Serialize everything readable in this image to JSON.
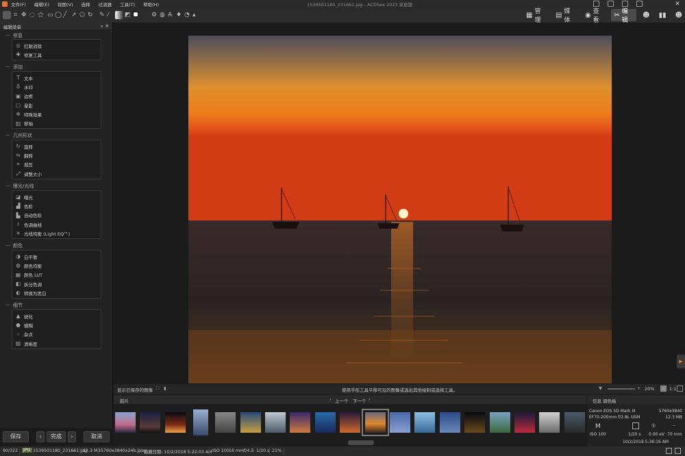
{
  "menu": [
    "文件(F)",
    "编辑(E)",
    "视图(V)",
    "选择",
    "过滤器",
    "工具(T)",
    "帮助(H)"
  ],
  "window_title": "1539501180_231661.jpg - ACDSee 2023 家庭版",
  "modes": [
    {
      "label": "管理",
      "icon": "grid-icon"
    },
    {
      "label": "媒体",
      "icon": "media-icon"
    },
    {
      "label": "查看",
      "icon": "eye-icon"
    },
    {
      "label": "编辑",
      "icon": "edit-icon"
    }
  ],
  "left_panel": {
    "title": "编辑菜单",
    "groups": [
      {
        "title": "修复",
        "items": [
          "红眼消除",
          "修复工具"
        ]
      },
      {
        "title": "添加",
        "items": [
          "文本",
          "水印",
          "边框",
          "晕影",
          "特殊效果",
          "移轴"
        ]
      },
      {
        "title": "几何形状",
        "items": [
          "旋转",
          "翻转",
          "裁剪",
          "调整大小"
        ]
      },
      {
        "title": "曝光/光线",
        "items": [
          "曝光",
          "色阶",
          "自动色阶",
          "色调曲线",
          "光线均衡 (Light EQ™)"
        ]
      },
      {
        "title": "颜色",
        "items": [
          "白平衡",
          "颜色均衡",
          "颜色 LUT",
          "拆分色调",
          "转换为黑白"
        ]
      },
      {
        "title": "细节",
        "items": [
          "锐化",
          "模糊",
          "杂点",
          "清晰度"
        ]
      }
    ]
  },
  "buttons": {
    "save": "保存",
    "done": "完成",
    "cancel": "取消"
  },
  "viewer_status": {
    "left": "显示已保存的图像",
    "hint": "使用手形工具平移可见的图像或选出其他绘制或选择工具。",
    "zoom": "20%",
    "ratio": "1:1"
  },
  "film": {
    "tab": "胶片",
    "prev": "上一个",
    "next": "下一个"
  },
  "info": {
    "tab": "信息 调色板",
    "camera": "Canon EOS 5D Mark III",
    "dims": "5760x3840",
    "lens": "EF70-200mm f/2.8L USM",
    "size": "12.3 MB",
    "mode": "M",
    "iso": "ISO 100",
    "shutter": "1/20 s",
    "ev": "0.00 eV",
    "focal": "70 mm",
    "dash": "--",
    "datetime": "10/2/2018 5:36:16 AM"
  },
  "statusbar": {
    "index": "90/322",
    "format": "JPG",
    "filename": "1539501180_231661.jpg",
    "filesize": "12.3 MB",
    "dimensions": "5760x3840x24b.jpeg",
    "taken": "拍摄日期: 10/2/2018 5:22:03 AM",
    "iso": "ISO 100",
    "focal": "16 mm",
    "aperture": "f/4.5",
    "shutter": "1/20 s",
    "zoom": "21%"
  },
  "colors": {
    "accent": "#e8732a",
    "bg": "#1b1b1b",
    "panel": "#232323"
  }
}
